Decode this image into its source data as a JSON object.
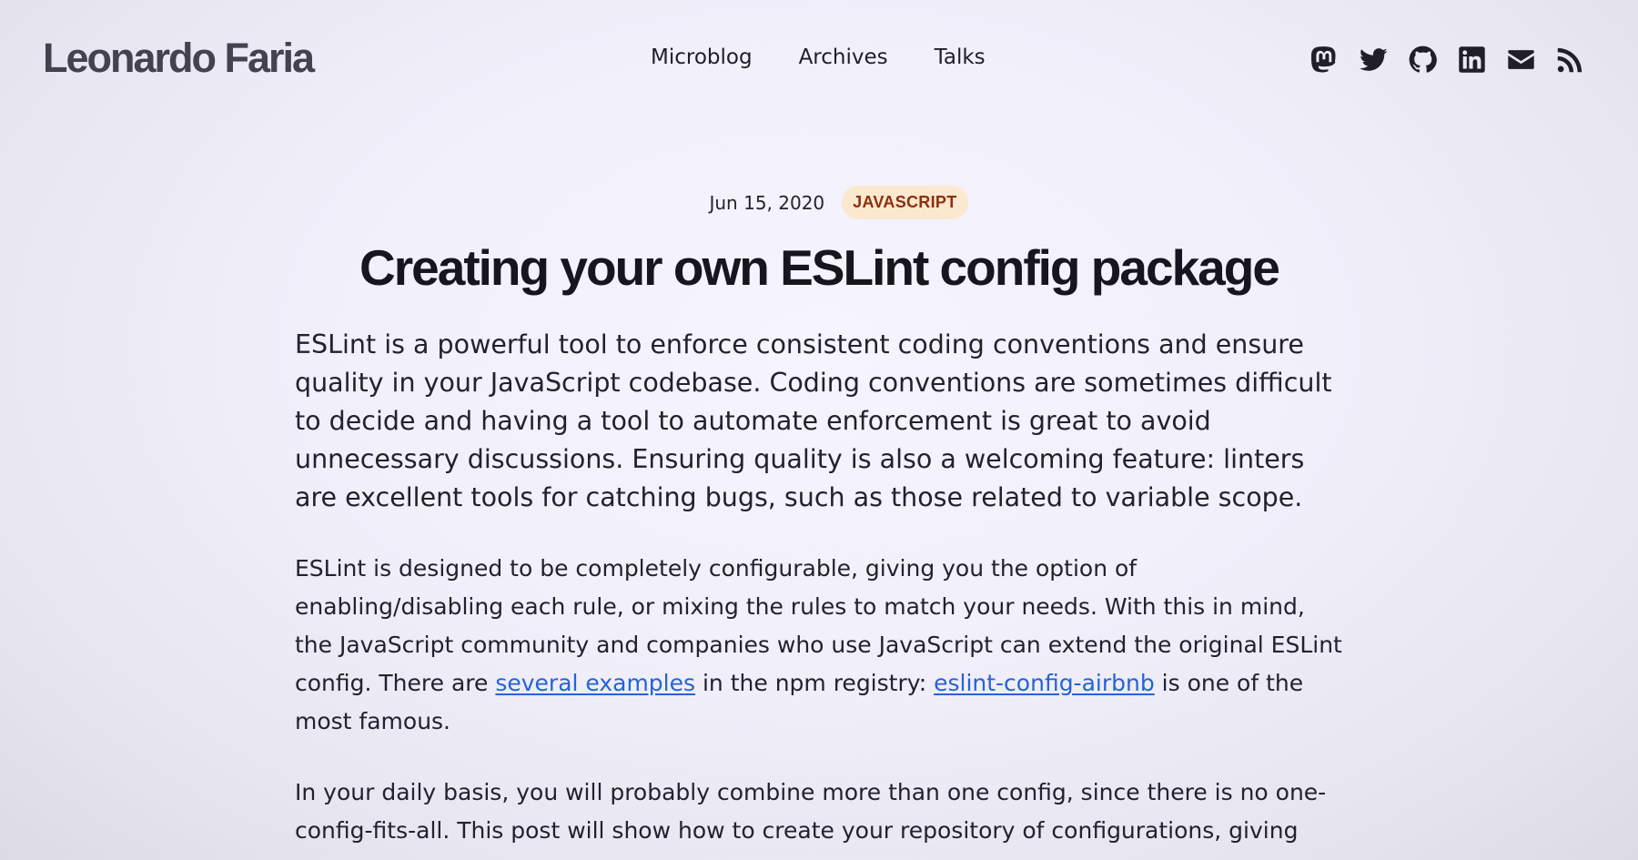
{
  "site": {
    "name": "Leonardo Faria"
  },
  "nav": {
    "items": [
      {
        "label": "Microblog"
      },
      {
        "label": "Archives"
      },
      {
        "label": "Talks"
      }
    ]
  },
  "social": {
    "icons": [
      "mastodon-icon",
      "twitter-icon",
      "github-icon",
      "linkedin-icon",
      "email-icon",
      "rss-icon"
    ]
  },
  "post": {
    "date": "Jun 15, 2020",
    "tag": "JAVASCRIPT",
    "title": "Creating your own ESLint config package",
    "paragraph1": "ESLint is a powerful tool to enforce consistent coding conventions and ensure quality in your JavaScript codebase. Coding conventions are sometimes difficult to decide and having a tool to automate enforcement is great to avoid unnecessary discussions. Ensuring quality is also a welcoming feature: linters are excellent tools for catching bugs, such as those related to variable scope.",
    "paragraph2": {
      "before_link1": "ESLint is designed to be completely configurable, giving you the option of enabling/disabling each rule, or mixing the rules to match your needs. With this in mind, the JavaScript community and companies who use JavaScript can extend the original ESLint config. There are ",
      "link1": "several examples",
      "between_links": " in the npm registry: ",
      "link2": "eslint-config-airbnb",
      "after_link2": " is one of the most famous."
    },
    "paragraph3": "In your daily basis, you will probably combine more than one config, since there is no one-config-fits-all. This post will show how to create your repository of configurations, giving"
  },
  "colors": {
    "link": "#2563d6",
    "tag_bg": "#fbe9cf",
    "tag_text": "#8d2f0f"
  }
}
